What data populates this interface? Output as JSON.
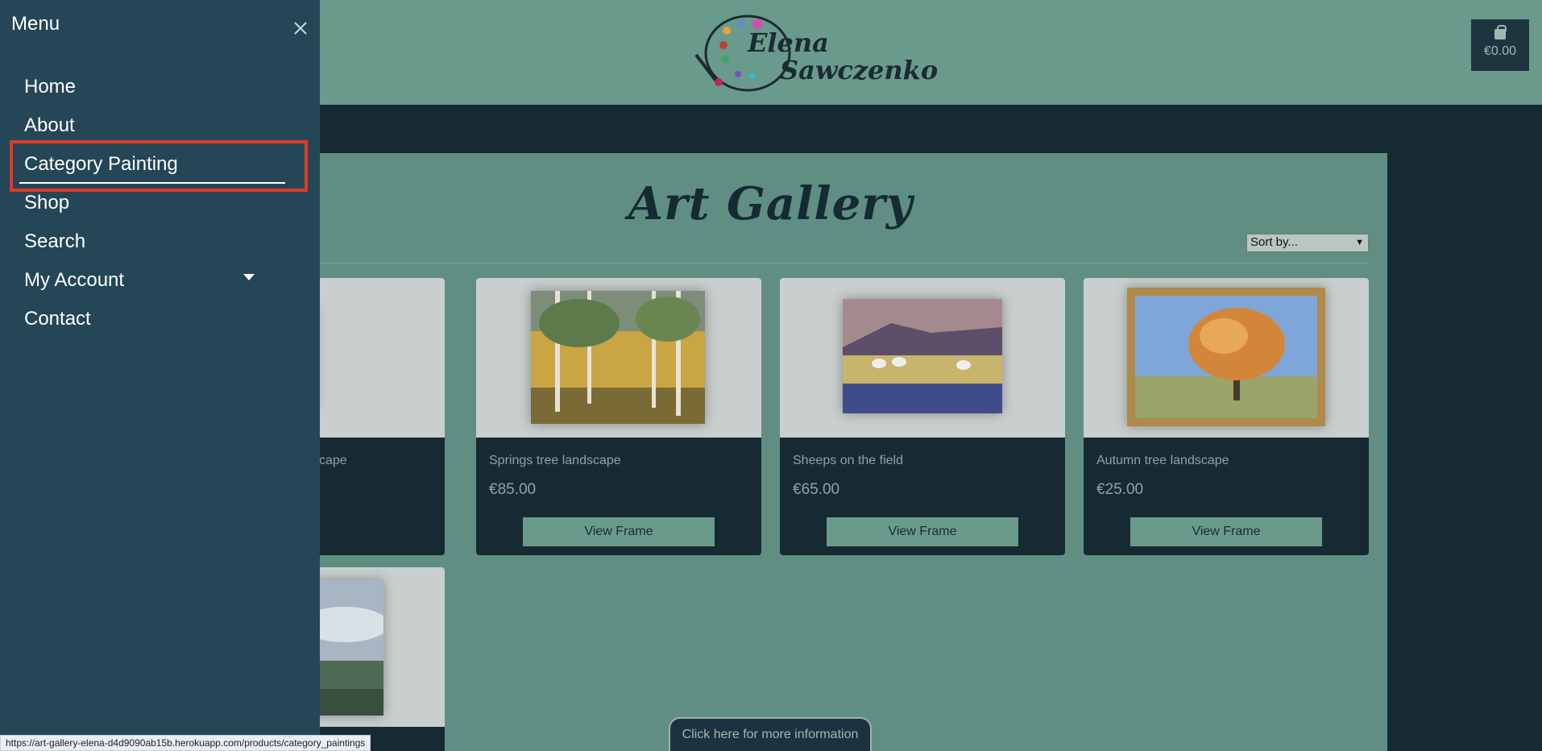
{
  "header": {
    "logo_line1": "Elena",
    "logo_line2": "Sawczenko",
    "cart_total": "€0.00"
  },
  "main": {
    "title": "Art Gallery",
    "sort": {
      "selected": "Sort by..."
    },
    "products": [
      {
        "title": "cape",
        "price": "",
        "button": "rame"
      },
      {
        "title": "Springs tree landscape",
        "price": "€85.00",
        "button": "View Frame"
      },
      {
        "title": "Sheeps on the field",
        "price": "€65.00",
        "button": "View Frame"
      },
      {
        "title": "Autumn tree landscape",
        "price": "€25.00",
        "button": "View Frame"
      }
    ],
    "info_button": "Click here for more information"
  },
  "menu": {
    "title": "Menu",
    "items": [
      {
        "label": "Home"
      },
      {
        "label": "About"
      },
      {
        "label": "Category Painting"
      },
      {
        "label": "Shop"
      },
      {
        "label": "Search"
      },
      {
        "label": "My Account"
      },
      {
        "label": "Contact"
      }
    ]
  },
  "status_url": "https://art-gallery-elena-d4d9090ab15b.herokuapp.com/products/category_paintings",
  "colors": {
    "menu_bg": "#244656",
    "highlight": "#e03a26",
    "card_bg": "#152a33",
    "header_bg": "#6a9a8c"
  },
  "icons": {
    "close": "close-icon",
    "cart": "shopping-bag-icon",
    "dropdown": "caret-down-icon"
  }
}
